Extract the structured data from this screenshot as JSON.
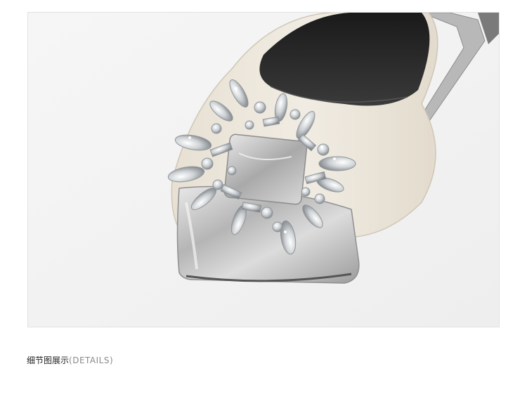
{
  "caption": {
    "title": "细节图展示",
    "subtitle": "(DETAILS)"
  },
  "photo": {
    "subject": "shoe-detail-photo",
    "background_color": "#f3f3f3",
    "leather_color": "#ece6da",
    "toe_color": "#c9c9c9",
    "lining_color": "#2a2a2a"
  }
}
